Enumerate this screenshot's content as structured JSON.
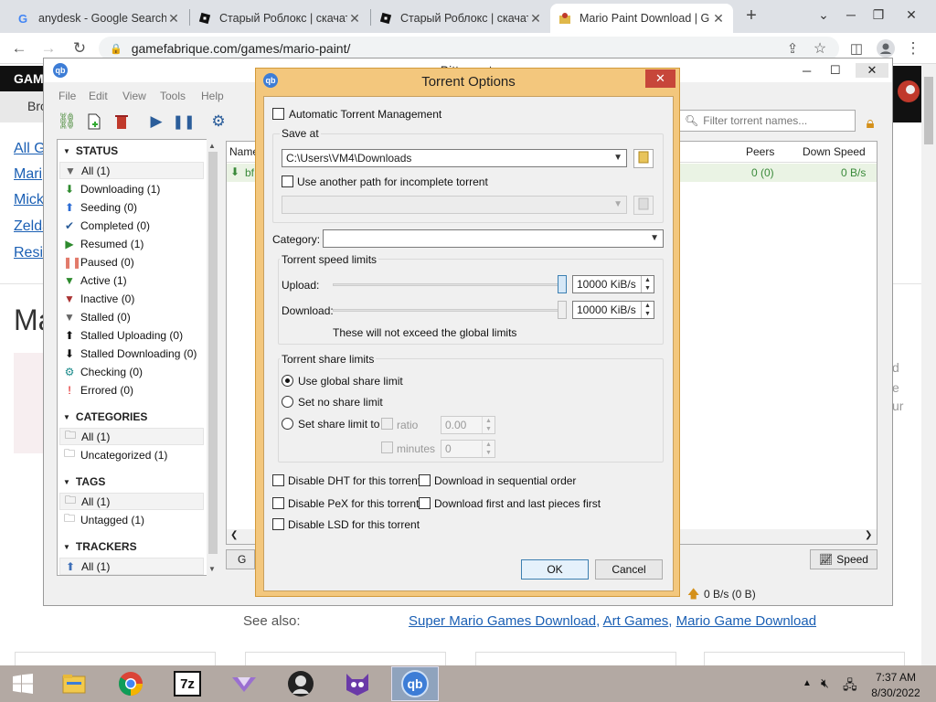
{
  "browser": {
    "tabs": [
      {
        "title": "anydesk - Google Search",
        "favicon": "google-icon"
      },
      {
        "title": "Старый Роблокс | скачать",
        "favicon": "roblox-icon"
      },
      {
        "title": "Старый Роблокс | скачать",
        "favicon": "roblox-icon"
      },
      {
        "title": "Mario Paint Download | G",
        "favicon": "gamefabrique-icon"
      }
    ],
    "new_tab": "+",
    "url": "gamefabrique.com/games/mario-paint/"
  },
  "webpage": {
    "logo": "GAM",
    "side_links": [
      "All G",
      "Mari",
      "Mick",
      "Zelda",
      "Resid"
    ],
    "heading_partial": "Ma",
    "right_partial": [
      "d",
      "e",
      "ur"
    ],
    "see_also_label": "See also:",
    "see_also_links": [
      "Super Mario Games Download",
      "Art Games",
      "Mario Game Download"
    ],
    "partial_left": "Bro",
    "list_partial_item": "bf"
  },
  "qbittorrent": {
    "title_partial": "qBittorrent",
    "menu": [
      "File",
      "Edit",
      "View",
      "Tools",
      "Help"
    ],
    "filter_placeholder": "Filter torrent names...",
    "sidebar": {
      "status_header": "STATUS",
      "status_items": [
        "All (1)",
        "Downloading (1)",
        "Seeding (0)",
        "Completed (0)",
        "Resumed (1)",
        "Paused (0)",
        "Active (1)",
        "Inactive (0)",
        "Stalled (0)",
        "Stalled Uploading (0)",
        "Stalled Downloading (0)",
        "Checking (0)",
        "Errored (0)"
      ],
      "categories_header": "CATEGORIES",
      "categories_items": [
        "All (1)",
        "Uncategorized (1)"
      ],
      "tags_header": "TAGS",
      "tags_items": [
        "All (1)",
        "Untagged (1)"
      ],
      "trackers_header": "TRACKERS",
      "trackers_items": [
        "All (1)"
      ]
    },
    "columns": {
      "name": "Name",
      "peers": "Peers",
      "down_speed": "Down Speed"
    },
    "row": {
      "peers": "0 (0)",
      "down_speed": "0 B/s"
    },
    "speed_button": "Speed",
    "general_tab_partial": "G",
    "status_up": "0 B/s (0 B)"
  },
  "dialog": {
    "title": "Torrent Options",
    "auto_mgmt": "Automatic Torrent Management",
    "save_at_label": "Save at",
    "save_path": "C:\\Users\\VM4\\Downloads",
    "other_path": "Use another path for incomplete torrent",
    "category_label": "Category:",
    "category_value": "",
    "speed_group": "Torrent speed limits",
    "upload_label": "Upload:",
    "upload_value": "10000 KiB/s",
    "download_label": "Download:",
    "download_value": "10000 KiB/s",
    "speed_note": "These will not exceed the global limits",
    "share_group": "Torrent share limits",
    "share_global": "Use global share limit",
    "share_none": "Set no share limit",
    "share_set": "Set share limit to",
    "ratio_label": "ratio",
    "ratio_value": "0.00",
    "minutes_label": "minutes",
    "minutes_value": "0",
    "dht": "Disable DHT for this torrent",
    "pex": "Disable PeX for this torrent",
    "lsd": "Disable LSD for this torrent",
    "sequential": "Download in sequential order",
    "first_last": "Download first and last pieces first",
    "ok": "OK",
    "cancel": "Cancel"
  },
  "taskbar": {
    "time": "7:37 AM",
    "date": "8/30/2022",
    "apps": [
      "windows-start-icon",
      "file-explorer-icon",
      "chrome-icon",
      "7zip-icon",
      "app-triangle-icon",
      "app-avatar-icon",
      "app-cat-icon",
      "qbittorrent-icon"
    ]
  }
}
